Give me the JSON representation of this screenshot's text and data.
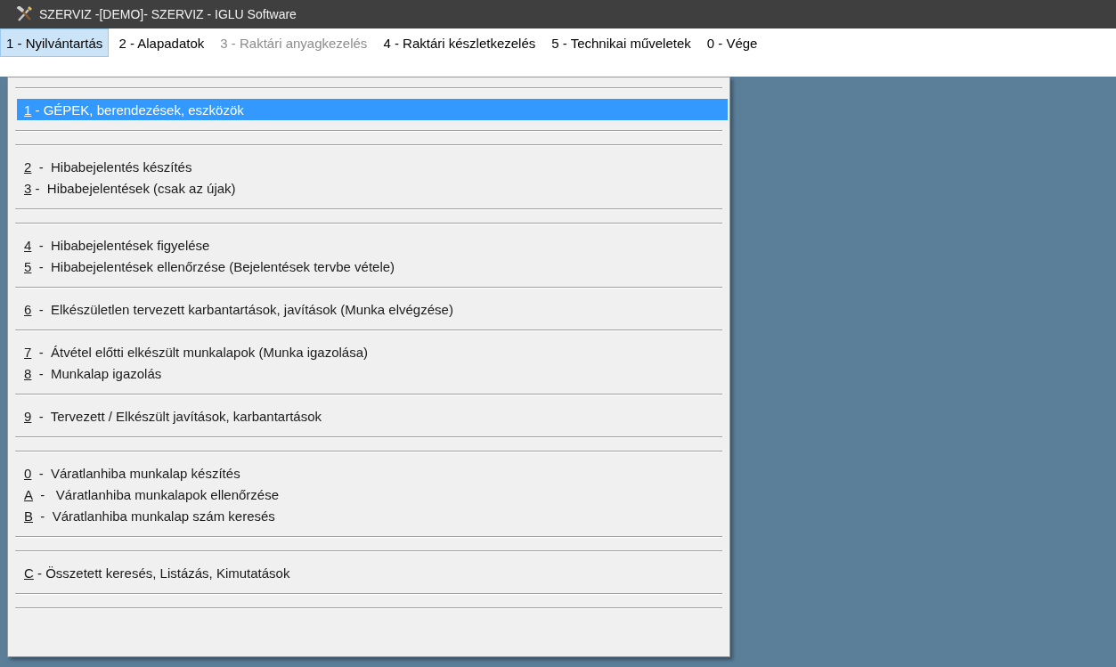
{
  "window": {
    "title": "SZERVIZ -[DEMO]- SZERVIZ - IGLU Software"
  },
  "menu_bar": [
    {
      "label": "1 - Nyilvántartás",
      "selected": true,
      "disabled": false
    },
    {
      "label": "2 - Alapadatok",
      "selected": false,
      "disabled": false
    },
    {
      "label": "3 - Raktári anyagkezelés",
      "selected": false,
      "disabled": true
    },
    {
      "label": "4 - Raktári készletkezelés",
      "selected": false,
      "disabled": false
    },
    {
      "label": "5 - Technikai műveletek",
      "selected": false,
      "disabled": false
    },
    {
      "label": "0 - Vége",
      "selected": false,
      "disabled": false
    }
  ],
  "dropdown": [
    {
      "kind": "separator"
    },
    {
      "kind": "item",
      "key": "1",
      "text": " - GÉPEK, berendezések, eszközök",
      "selected": true
    },
    {
      "kind": "double-separator"
    },
    {
      "kind": "item",
      "key": "2",
      "text": "  -  Hibabejelentés készítés",
      "selected": false
    },
    {
      "kind": "item",
      "key": "3",
      "text": " -  Hibabejelentések (csak az újak)",
      "selected": false
    },
    {
      "kind": "double-separator"
    },
    {
      "kind": "item",
      "key": "4",
      "text": "  -  Hibabejelentések figyelése",
      "selected": false
    },
    {
      "kind": "item",
      "key": "5",
      "text": "  -  Hibabejelentések ellenőrzése (Bejelentések tervbe vétele)",
      "selected": false
    },
    {
      "kind": "separator"
    },
    {
      "kind": "item",
      "key": "6",
      "text": "  -  Elkészületlen tervezett karbantartások, javítások (Munka elvégzése)",
      "selected": false
    },
    {
      "kind": "separator"
    },
    {
      "kind": "item",
      "key": "7",
      "text": "  -  Átvétel előtti elkészült munkalapok (Munka igazolása)",
      "selected": false
    },
    {
      "kind": "item",
      "key": "8",
      "text": "  -  Munkalap igazolás",
      "selected": false
    },
    {
      "kind": "separator"
    },
    {
      "kind": "item",
      "key": "9",
      "text": "  -  Tervezett / Elkészült javítások, karbantartások",
      "selected": false
    },
    {
      "kind": "double-separator"
    },
    {
      "kind": "item",
      "key": "0",
      "text": "  -  Váratlanhiba munkalap készítés",
      "selected": false
    },
    {
      "kind": "item",
      "key": "A",
      "text": "  -   Váratlanhiba munkalapok ellenőrzése",
      "selected": false
    },
    {
      "kind": "item",
      "key": "B",
      "text": "  -  Váratlanhiba munkalap szám keresés",
      "selected": false
    },
    {
      "kind": "double-separator"
    },
    {
      "kind": "item",
      "key": "C",
      "text": " - Összetett keresés, Listázás, Kimutatások",
      "selected": false
    },
    {
      "kind": "double-separator"
    }
  ]
}
